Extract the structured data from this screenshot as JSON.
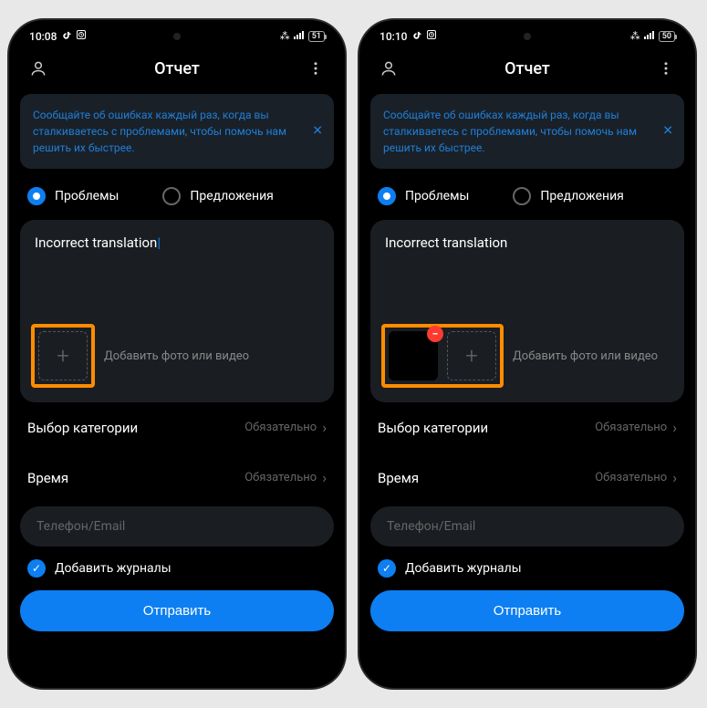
{
  "screens": [
    {
      "status": {
        "time": "10:08",
        "battery": "51"
      },
      "header": {
        "title": "Отчет"
      },
      "banner": {
        "text": "Сообщайте об ошибках каждый раз, когда вы сталкиваетесь с проблемами, чтобы помочь нам решить их быстрее."
      },
      "radio": {
        "problems": "Проблемы",
        "suggestions": "Предложения"
      },
      "input": {
        "value": "Incorrect translation"
      },
      "media": {
        "label": "Добавить фото или видео",
        "has_attachment": false
      },
      "rows": {
        "category": {
          "label": "Выбор категории",
          "hint": "Обязательно"
        },
        "time": {
          "label": "Время",
          "hint": "Обязательно"
        }
      },
      "contact": {
        "placeholder": "Телефон/Email"
      },
      "logs": {
        "label": "Добавить журналы"
      },
      "submit": {
        "label": "Отправить"
      }
    },
    {
      "status": {
        "time": "10:10",
        "battery": "50"
      },
      "header": {
        "title": "Отчет"
      },
      "banner": {
        "text": "Сообщайте об ошибках каждый раз, когда вы сталкиваетесь с проблемами, чтобы помочь нам решить их быстрее."
      },
      "radio": {
        "problems": "Проблемы",
        "suggestions": "Предложения"
      },
      "input": {
        "value": "Incorrect translation"
      },
      "media": {
        "label": "Добавить фото или видео",
        "has_attachment": true
      },
      "rows": {
        "category": {
          "label": "Выбор категории",
          "hint": "Обязательно"
        },
        "time": {
          "label": "Время",
          "hint": "Обязательно"
        }
      },
      "contact": {
        "placeholder": "Телефон/Email"
      },
      "logs": {
        "label": "Добавить журналы"
      },
      "submit": {
        "label": "Отправить"
      }
    }
  ]
}
